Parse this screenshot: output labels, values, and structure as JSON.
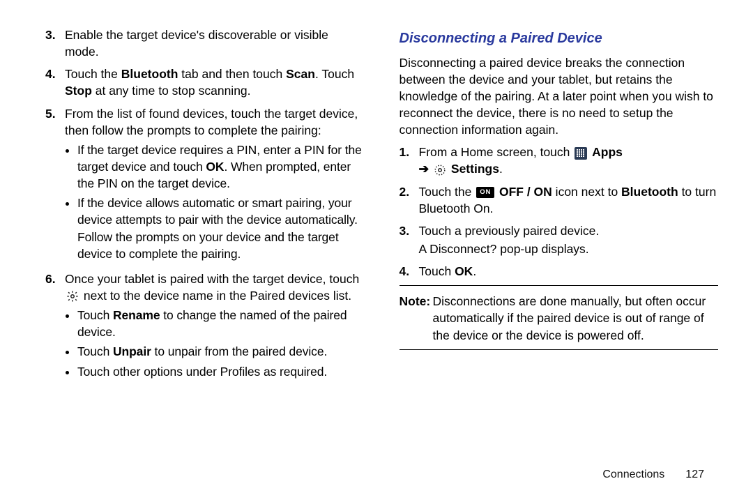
{
  "left": {
    "item3": "Enable the target device's discoverable or visible mode.",
    "item4_a": "Touch the ",
    "item4_bold1": "Bluetooth",
    "item4_b": " tab and then touch ",
    "item4_bold2": "Scan",
    "item4_c": ". Touch ",
    "item4_bold3": "Stop",
    "item4_d": " at any time to stop scanning.",
    "item5": "From the list of found devices, touch the target device, then follow the prompts to complete the pairing:",
    "b1_a": "If the target device requires a PIN, enter a PIN for the target device and touch ",
    "b1_bold": "OK",
    "b1_b": ". When prompted, enter the PIN on the target device.",
    "b2": "If the device allows automatic or smart pairing, your device attempts to pair with the device automatically. Follow the prompts on your device and the target device to complete the pairing.",
    "item6_a": "Once your tablet is paired with the target device, touch ",
    "item6_b": " next to the device name in the Paired devices list.",
    "b3_a": "Touch ",
    "b3_bold": "Rename",
    "b3_b": " to change the named of the paired device.",
    "b4_a": "Touch ",
    "b4_bold": "Unpair",
    "b4_b": " to unpair from the paired device.",
    "b5": "Touch other options under Profiles as required."
  },
  "right": {
    "heading": "Disconnecting a Paired Device",
    "intro": "Disconnecting a paired device breaks the connection between the device and your tablet, but retains the knowledge of the pairing. At a later point when you wish to reconnect the device, there is no need to setup the connection information again.",
    "s1_a": "From a Home screen, touch ",
    "s1_bold_apps": "Apps",
    "s1_bold_settings": "Settings",
    "s1_dot": ".",
    "s2_a": "Touch the ",
    "s2_on": "ON",
    "s2_bold1": "OFF / ON",
    "s2_b": " icon next to ",
    "s2_bold2": "Bluetooth",
    "s2_c": " to turn Bluetooth On.",
    "s3_a": "Touch a previously paired device.",
    "s3_b": "A Disconnect? pop-up displays.",
    "s4_a": "Touch ",
    "s4_bold": "OK",
    "s4_b": ".",
    "note_lbl": "Note:",
    "note_txt": "Disconnections are done manually, but often occur automatically if the paired device is out of range of the device or the device is powered off."
  },
  "footer": {
    "section": "Connections",
    "page": "127"
  }
}
